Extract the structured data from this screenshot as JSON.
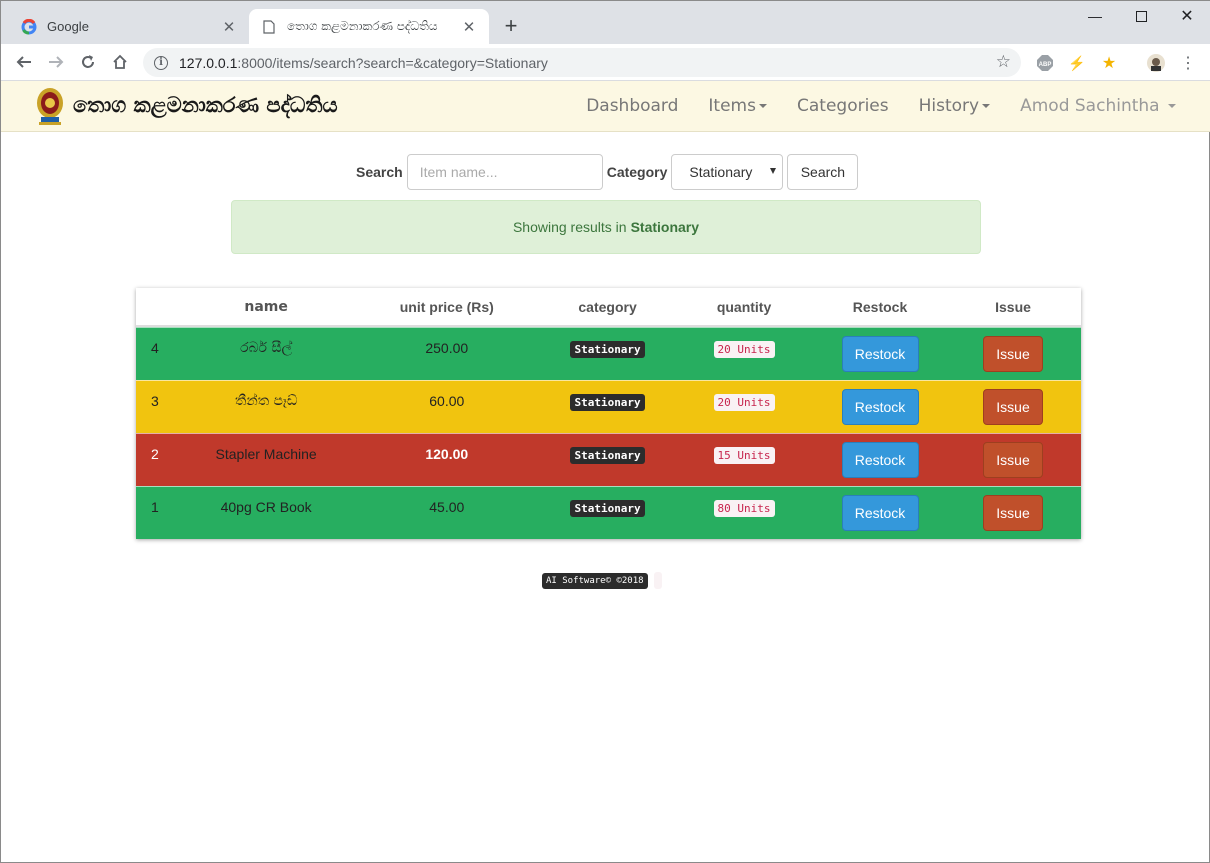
{
  "browser": {
    "tabs": [
      {
        "title": "Google"
      },
      {
        "title": "තොග කළමනාකරණ පද්ධතිය"
      }
    ],
    "url_host": "127.0.0.1",
    "url_rest": ":8000/items/search?search=&category=Stationary"
  },
  "navbar": {
    "brand": "තොග කළමනාකරණ පද්ධතිය",
    "items": [
      "Dashboard",
      "Items",
      "Categories",
      "History",
      "Amod Sachintha"
    ]
  },
  "search": {
    "label": "Search",
    "placeholder": "Item name...",
    "category_label": "Category",
    "category_value": "Stationary",
    "button": "Search"
  },
  "alert": {
    "text": "Showing results in",
    "category": "Stationary"
  },
  "table": {
    "headers": [
      "",
      "name",
      "unit price (Rs)",
      "category",
      "quantity",
      "Restock",
      "Issue"
    ],
    "rows": [
      {
        "id": "4",
        "name": "රබර් සීල්",
        "price": "250.00",
        "category": "Stationary",
        "quantity": "20 Units",
        "restock": "Restock",
        "issue": "Issue",
        "status": "green"
      },
      {
        "id": "3",
        "name": "තීන්ත පෑඩ්",
        "price": "60.00",
        "category": "Stationary",
        "quantity": "20 Units",
        "restock": "Restock",
        "issue": "Issue",
        "status": "yellow"
      },
      {
        "id": "2",
        "name": "Stapler Machine",
        "price": "120.00",
        "category": "Stationary",
        "quantity": "15 Units",
        "restock": "Restock",
        "issue": "Issue",
        "status": "red"
      },
      {
        "id": "1",
        "name": "40pg CR Book",
        "price": "45.00",
        "category": "Stationary",
        "quantity": "80 Units",
        "restock": "Restock",
        "issue": "Issue",
        "status": "green"
      }
    ]
  },
  "footer": {
    "text": "AI Software© ©2018"
  },
  "colors": {
    "green": "#27ae60",
    "yellow": "#f1c40f",
    "red": "#c0392b",
    "restock": "#3498db",
    "issue": "#c0502b"
  }
}
